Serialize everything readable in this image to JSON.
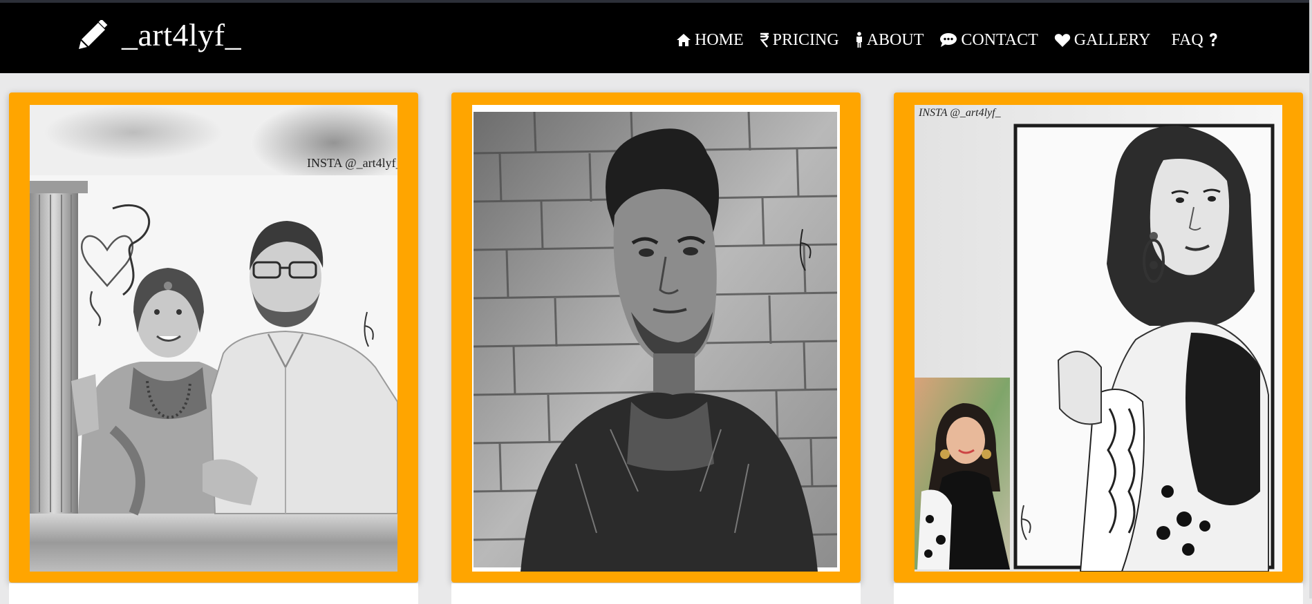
{
  "brand": {
    "name": "_art4lyf_",
    "icon": "pencil-icon"
  },
  "nav": {
    "items": [
      {
        "label": "HOME",
        "icon": "home-icon"
      },
      {
        "label": "PRICING",
        "icon": "rupee-icon"
      },
      {
        "label": "ABOUT",
        "icon": "person-icon"
      },
      {
        "label": "CONTACT",
        "icon": "chat-icon"
      },
      {
        "label": "GALLERY",
        "icon": "heart-icon"
      },
      {
        "label": "FAQ",
        "icon": "question-icon"
      }
    ]
  },
  "gallery": {
    "cards": [
      {
        "watermark": "INSTA @_art4lyf_",
        "subject": "couple-portrait"
      },
      {
        "watermark": "",
        "subject": "man-portrait"
      },
      {
        "watermark": "INSTA @_art4lyf_",
        "subject": "woman-portrait"
      }
    ]
  },
  "colors": {
    "navbar": "#000000",
    "accent": "#ffa500",
    "background": "#e9e9ea",
    "text": "#ffffff"
  }
}
